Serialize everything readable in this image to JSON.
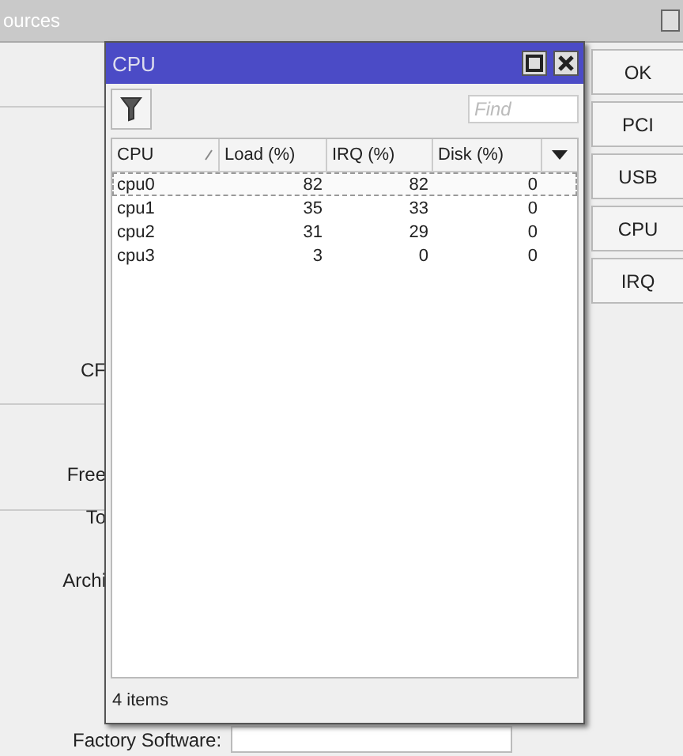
{
  "back_window": {
    "title": "ources",
    "labels": [
      "CF",
      "Free",
      "To",
      "Archi"
    ],
    "factory_label": "Factory Software:",
    "buttons": [
      "OK",
      "PCI",
      "USB",
      "CPU",
      "IRQ"
    ]
  },
  "cpu_window": {
    "title": "CPU",
    "search": {
      "placeholder": "Find"
    },
    "table": {
      "columns": [
        {
          "label": "CPU",
          "sorted": true
        },
        {
          "label": "Load (%)",
          "sorted": false
        },
        {
          "label": "IRQ (%)",
          "sorted": false
        },
        {
          "label": "Disk (%)",
          "sorted": false
        }
      ],
      "rows": [
        {
          "cells": [
            "cpu0",
            "82",
            "82",
            "0"
          ],
          "selected": true
        },
        {
          "cells": [
            "cpu1",
            "35",
            "33",
            "0"
          ],
          "selected": false
        },
        {
          "cells": [
            "cpu2",
            "31",
            "29",
            "0"
          ],
          "selected": false
        },
        {
          "cells": [
            "cpu3",
            "3",
            "0",
            "0"
          ],
          "selected": false
        }
      ]
    },
    "status": "4 items"
  }
}
